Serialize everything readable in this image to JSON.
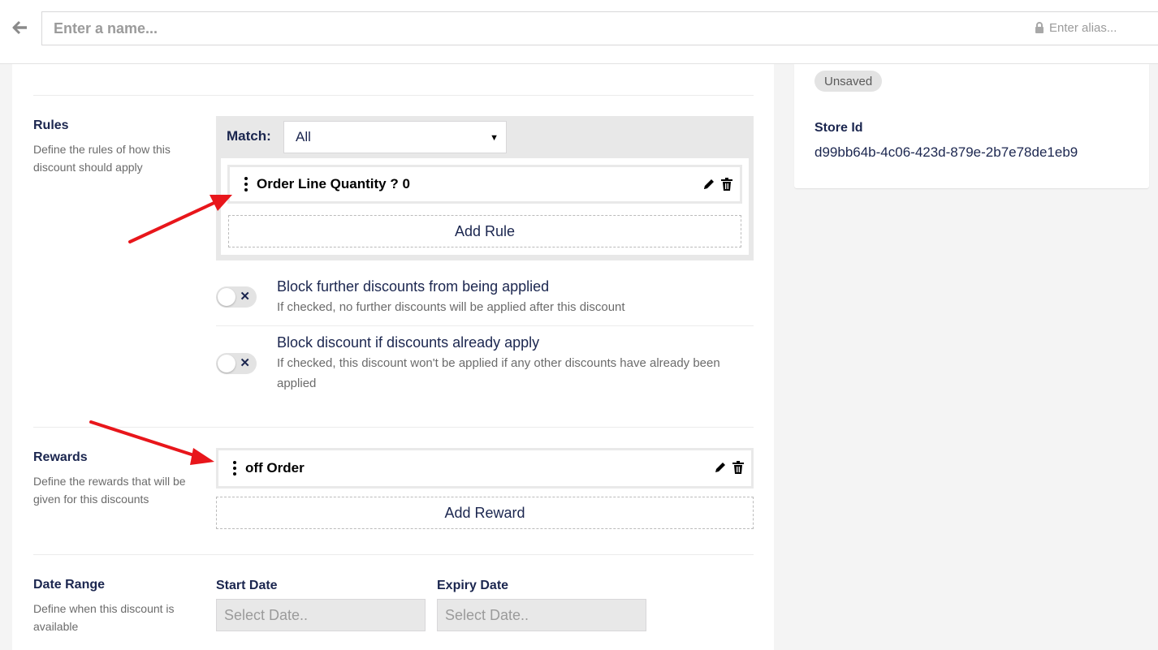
{
  "header": {
    "name_placeholder": "Enter a name...",
    "alias_placeholder": "Enter alias..."
  },
  "rules": {
    "title": "Rules",
    "description": "Define the rules of how this discount should apply",
    "match_label": "Match:",
    "match_value": "All",
    "items": [
      {
        "label": "Order Line Quantity ? 0"
      }
    ],
    "add_label": "Add Rule"
  },
  "options": [
    {
      "title": "Block further discounts from being applied",
      "description": "If checked, no further discounts will be applied after this discount",
      "checked": false
    },
    {
      "title": "Block discount if discounts already apply",
      "description": "If checked, this discount won't be applied if any other discounts have already been applied",
      "checked": false
    }
  ],
  "rewards": {
    "title": "Rewards",
    "description": "Define the rewards that will be given for this discounts",
    "items": [
      {
        "label": "off Order"
      }
    ],
    "add_label": "Add Reward"
  },
  "date_range": {
    "title": "Date Range",
    "description": "Define when this discount is available",
    "start_label": "Start Date",
    "start_placeholder": "Select Date..",
    "expiry_label": "Expiry Date",
    "expiry_placeholder": "Select Date.."
  },
  "side": {
    "status_badge": "Unsaved",
    "store_id_label": "Store Id",
    "store_id_value": "d99bb64b-4c06-423d-879e-2b7e78de1eb9"
  },
  "icons": {
    "back": "arrow-left-icon",
    "lock": "lock-icon",
    "drag": "drag-handle-icon",
    "edit": "pencil-icon",
    "delete": "trash-icon",
    "toggle_off": "close-icon"
  },
  "colors": {
    "text_primary": "#1b264f",
    "annotation_arrow": "#e8161b",
    "panel_gray": "#e8e8e8"
  }
}
